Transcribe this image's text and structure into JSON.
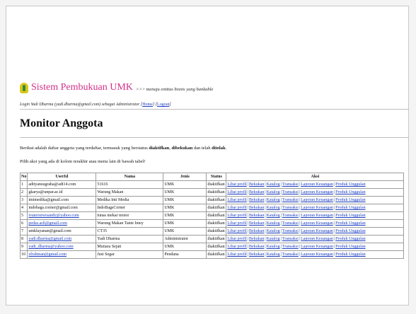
{
  "brand": {
    "title": "Sistem Pembukuan UMK",
    "tagline": ">>> menuju entitas bisnis yang bankable"
  },
  "login": {
    "prefix": "Login Yadi Dharma (yadi.dharma@gmail.com) sebagai Administrator [",
    "home": "Home",
    "mid": "] [",
    "logout": "Logout",
    "suffix": "]"
  },
  "page_title": "Monitor Anggota",
  "description": {
    "prefix": "Berikut adalah daftar anggota yang terdaftar, termasuk yang berstatus ",
    "s1": "diaktifkan",
    "comma": ", ",
    "s2": "dibekukan",
    "mid": " dan telah ",
    "s3": "ditolak",
    "end": "."
  },
  "instruction": "Pilih aksi yang ada di kolom terakhir atau menu lain di bawah tabel!",
  "table": {
    "headers": [
      "No",
      "UserId",
      "Nama",
      "Jenis",
      "Status",
      "Aksi"
    ],
    "actions": [
      "Lihat profil",
      "Bekukan",
      "Katalog",
      "Transaksi",
      "Laporan Keuangan",
      "Produk Unggulan"
    ],
    "rows": [
      {
        "no": "1",
        "userid": "adityansugraha@adt14.com",
        "link": false,
        "nama": "51616",
        "jenis": "UMK",
        "status": "diaktifkan"
      },
      {
        "no": "2",
        "userid": "gkarya@unpar.ac.id",
        "link": false,
        "nama": "Warung Makan",
        "jenis": "UMK",
        "status": "diaktifkan"
      },
      {
        "no": "3",
        "userid": "imimedika@gmail.com",
        "link": false,
        "nama": "Medika Inti Media",
        "jenis": "UMK",
        "status": "diaktifkan"
      },
      {
        "no": "4",
        "userid": "indobags.corner@gmail.com",
        "link": false,
        "nama": "IndoBagsCorner",
        "jenis": "UMK",
        "status": "diaktifkan"
      },
      {
        "no": "5",
        "userid": "ivanrosiwisandy@yahoo.com",
        "link": true,
        "nama": "tunas mekar motor",
        "jenis": "UMK",
        "status": "diaktifkan"
      },
      {
        "no": "6",
        "userid": "pedas.asli@gmail.com",
        "link": true,
        "nama": "Warung Makan Tante Imey",
        "jenis": "UMK",
        "status": "diaktifkan"
      },
      {
        "no": "7",
        "userid": "umklayanan@gmail.com",
        "link": false,
        "nama": "CT35",
        "jenis": "UMK",
        "status": "diaktifkan"
      },
      {
        "no": "8",
        "userid": "yadi.dharma@gmail.com",
        "link": true,
        "nama": "Yadi Dharma",
        "jenis": "Administrator",
        "status": "diaktifkan"
      },
      {
        "no": "9",
        "userid": "yadi_dharma@yahoo.com",
        "link": true,
        "nama": "Mutiara Sejati",
        "jenis": "UMK",
        "status": "diaktifkan"
      },
      {
        "no": "10",
        "userid": "zfrahman@gmail.com",
        "link": true,
        "nama": "Just Segar",
        "jenis": "Pendana",
        "status": "diaktifkan"
      }
    ]
  },
  "colors": {
    "brand": "#d32f8a",
    "link": "#1a3dc2"
  },
  "icons": {
    "logo": "lightbulb-logo-icon"
  }
}
